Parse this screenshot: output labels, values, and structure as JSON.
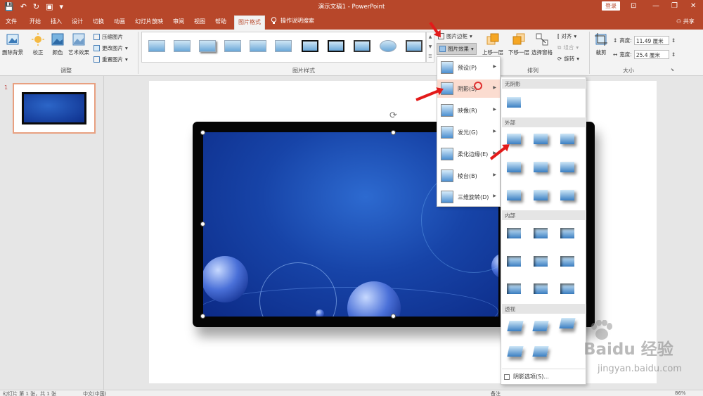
{
  "window": {
    "title": "演示文稿1 - PowerPoint",
    "login_label": "登录",
    "share_label": "共享",
    "minimize": "—",
    "restore": "❐",
    "close": "✕",
    "ribbon_options": "⊡"
  },
  "quick_access": {
    "save": "💾",
    "undo": "↶",
    "redo": "↻",
    "present": "▣",
    "customize": "▾"
  },
  "tabs": [
    "文件",
    "开始",
    "插入",
    "设计",
    "切换",
    "动画",
    "幻灯片放映",
    "审阅",
    "视图",
    "帮助",
    "图片格式"
  ],
  "active_tab": "图片格式",
  "tell_me": "操作说明搜索",
  "ribbon": {
    "adjust": {
      "remove_bg": "删除背景",
      "corrections": "校正",
      "color": "颜色",
      "artistic": "艺术效果",
      "compress": "压缩图片",
      "change": "更改图片",
      "reset": "重置图片",
      "group_label": "调整"
    },
    "styles": {
      "group_label": "图片样式",
      "border_label": "图片边框",
      "effects_label": "图片效果",
      "gallery_count": 11
    },
    "arrange": {
      "bring_forward": "上移一层",
      "send_backward": "下移一层",
      "selection_pane": "选择窗格",
      "align": "对齐",
      "group": "组合",
      "rotate": "旋转",
      "group_label": "排列"
    },
    "size": {
      "crop": "裁剪",
      "height_label": "高度:",
      "height_value": "11.49 厘米",
      "width_label": "宽度:",
      "width_value": "25.4 厘米",
      "group_label": "大小"
    }
  },
  "slides": {
    "number": "1"
  },
  "effects_menu": {
    "items": [
      "预设(P)",
      "阴影(S)",
      "映像(R)",
      "发光(G)",
      "柔化边缘(E)",
      "棱台(B)",
      "三维旋转(D)"
    ],
    "active_index": 1
  },
  "shadow_menu": {
    "sections": [
      "无阴影",
      "外部",
      "内部",
      "透视"
    ],
    "footer": "阴影选项(S)..."
  },
  "statusbar": {
    "slide_info": "幻灯片 第 1 张，共 1 张",
    "language": "中文(中国)",
    "notes": "备注",
    "zoom": "86%"
  },
  "watermark": {
    "brand": "Baidu 经验",
    "url": "jingyan.baidu.com"
  },
  "colors": {
    "accent": "#b7472a",
    "menu_highlight": "#fbdcd0",
    "annotation": "#e31a1a"
  }
}
